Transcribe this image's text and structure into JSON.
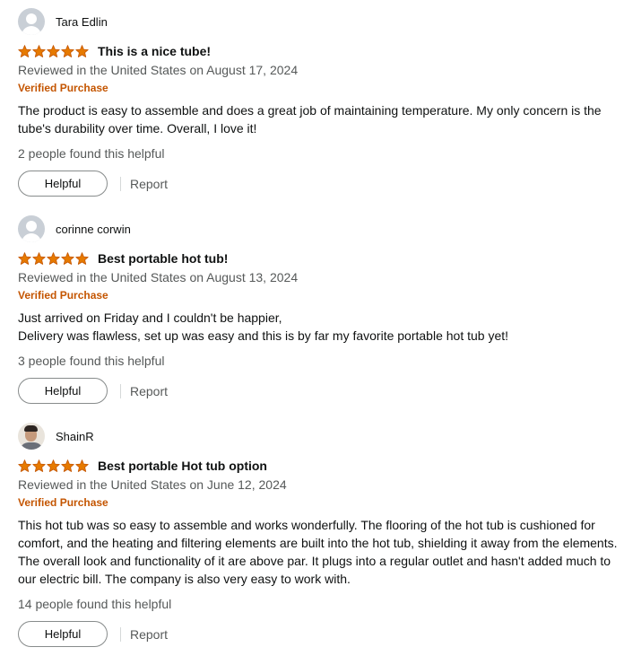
{
  "reviews": [
    {
      "name": "Tara Edlin",
      "title": "This is a nice tube!",
      "rating": 5,
      "date": "Reviewed in the United States on August 17, 2024",
      "verified": "Verified Purchase",
      "body": [
        "The product is easy to assemble and does a great job of maintaining temperature. My only concern is the tube's durability over time. Overall, I love it!"
      ],
      "helpful_count": "2 people found this helpful",
      "helpful_label": "Helpful",
      "report_label": "Report"
    },
    {
      "name": "corinne corwin",
      "title": "Best portable hot tub!",
      "rating": 5,
      "date": "Reviewed in the United States on August 13, 2024",
      "verified": "Verified Purchase",
      "body": [
        "Just arrived on Friday and I couldn't be happier,",
        "Delivery was flawless, set up was easy and this is by far my favorite portable hot tub yet!"
      ],
      "helpful_count": "3 people found this helpful",
      "helpful_label": "Helpful",
      "report_label": "Report"
    },
    {
      "name": "ShainR",
      "title": "Best portable Hot tub option",
      "rating": 5,
      "date": "Reviewed in the United States on June 12, 2024",
      "verified": "Verified Purchase",
      "body": [
        "This hot tub was so easy to assemble and works wonderfully. The flooring of the hot tub is cushioned for comfort, and the heating and filtering elements are built into the hot tub, shielding it away from the elements. The overall look and functionality of it are above par. It plugs into a regular outlet and hasn't added much to our electric bill. The company is also very easy to work with."
      ],
      "helpful_count": "14 people found this helpful",
      "helpful_label": "Helpful",
      "report_label": "Report"
    }
  ],
  "colors": {
    "star": "#E67A00",
    "verified": "#C45500",
    "muted": "#565959"
  }
}
